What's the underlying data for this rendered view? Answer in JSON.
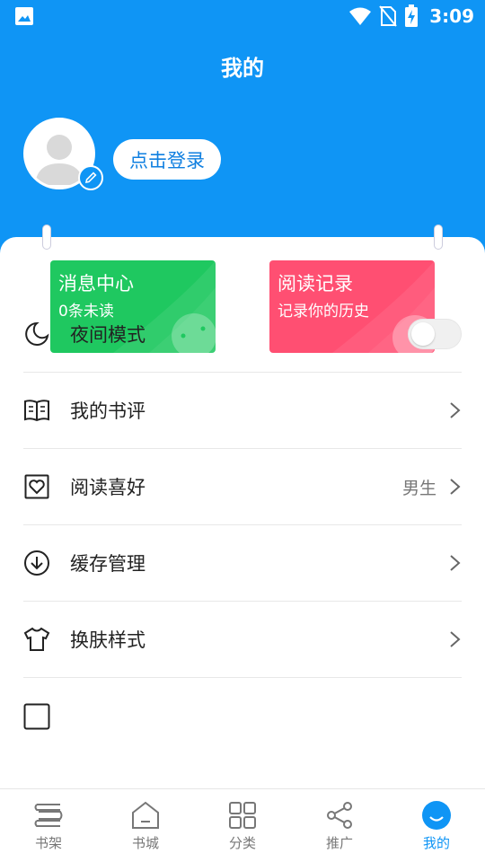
{
  "status_bar": {
    "time": "3:09"
  },
  "header": {
    "title": "我的",
    "login_label": "点击登录"
  },
  "cards": [
    {
      "title": "消息中心",
      "subtitle": "0条未读",
      "color": "#1fc860"
    },
    {
      "title": "阅读记录",
      "subtitle": "记录你的历史",
      "color": "#ff4f72"
    }
  ],
  "menu": {
    "items": [
      {
        "label": "夜间模式",
        "icon": "moon-icon",
        "toggle_on": false
      },
      {
        "label": "我的书评",
        "icon": "book-review-icon"
      },
      {
        "label": "阅读喜好",
        "icon": "heart-frame-icon",
        "value": "男生"
      },
      {
        "label": "缓存管理",
        "icon": "download-circle-icon"
      },
      {
        "label": "换肤样式",
        "icon": "shirt-icon"
      }
    ]
  },
  "tabs": [
    {
      "label": "书架",
      "icon": "bookshelf-icon"
    },
    {
      "label": "书城",
      "icon": "home-icon"
    },
    {
      "label": "分类",
      "icon": "grid-icon"
    },
    {
      "label": "推广",
      "icon": "share-icon"
    },
    {
      "label": "我的",
      "icon": "smile-icon",
      "active": true
    }
  ],
  "colors": {
    "brand": "#0f95f5",
    "text": "#222222",
    "muted": "#777777"
  }
}
